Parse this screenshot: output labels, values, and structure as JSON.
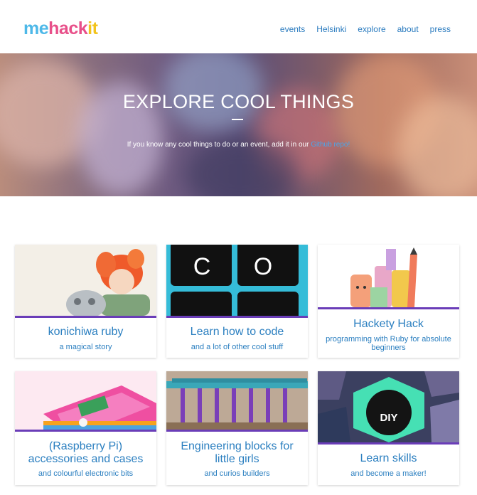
{
  "logo": {
    "me": "me",
    "hack": "hack",
    "it": "it"
  },
  "nav": [
    "events",
    "Helsinki",
    "explore",
    "about",
    "press"
  ],
  "hero": {
    "title": "EXPLORE COOL THINGS",
    "subtitle_text": "If you know any cool things to do or an event, add it in our ",
    "subtitle_link": "Github repo!"
  },
  "colors": {
    "accent": "#2b7fc0",
    "card_rule": "#6a3db8",
    "logo_me": "#4db8e8",
    "logo_hack": "#e8508a",
    "logo_it": "#f2c41d"
  },
  "cards": [
    {
      "title": "konichiwa ruby",
      "subtitle": "a magical story",
      "image": "girl-and-robot-illustration"
    },
    {
      "title": "Learn how to code",
      "subtitle": "and a lot of other cool stuff",
      "image": "keyboard-keys-co"
    },
    {
      "title": "Hackety Hack",
      "subtitle": "programming with Ruby for absolute beginners",
      "image": "pencils-illustration"
    },
    {
      "title": "(Raspberry Pi) accessories and cases",
      "subtitle": "and colourful electronic bits",
      "image": "raspberry-pi-case-photo"
    },
    {
      "title": "Engineering blocks for little girls",
      "subtitle": "and curios builders",
      "image": "engineering-toy-photo"
    },
    {
      "title": "Learn skills",
      "subtitle": "and become a maker!",
      "image": "diy-badge-illustration"
    }
  ]
}
